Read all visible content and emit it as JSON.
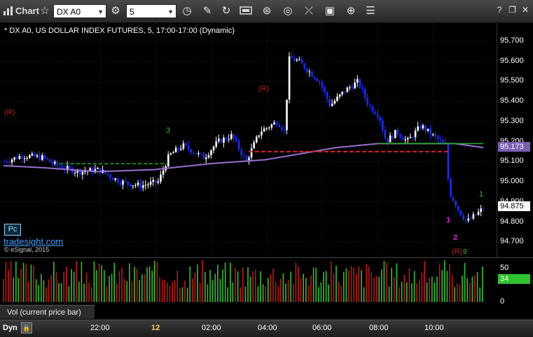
{
  "toolbar": {
    "chart_label": "Chart",
    "symbol_value": "DX A0",
    "interval_value": "5"
  },
  "chart": {
    "title": "* DX A0, US DOLLAR INDEX FUTURES, 5, 17:00-17:00 (Dynamic)",
    "price_labels": [
      "95.700",
      "95.600",
      "95.500",
      "95.400",
      "95.300",
      "95.200",
      "95.100",
      "95.000",
      "94.900",
      "94.800",
      "94.700"
    ],
    "last_price": "94.875",
    "ma_price": "95.173",
    "pc_tag": "Pc",
    "logo_text": "tradesight.com",
    "copyright": "© eSignal, 2015",
    "annotations": {
      "r_left": "(R)",
      "r_mid": "(R)",
      "r_bottom": "(R)",
      "count_3": "3",
      "count_1_green": "1",
      "count_1_magenta": "1",
      "count_2_magenta": "2",
      "count_9": "9"
    },
    "colors": {
      "up_candle": "#ffffff",
      "down_candle": "#1a2bff",
      "ma_line": "#9a6fd0",
      "support_line": "#e02020",
      "green_line": "#20b020",
      "setup_text": "#2fc22f",
      "annotation_red": "#c01818",
      "magenta": "#e020e0"
    }
  },
  "volume": {
    "label": "Vol (current price bar)",
    "scale_labels": [
      "50",
      "0"
    ],
    "current": "34"
  },
  "timeaxis": {
    "dyn_label": "Dyn",
    "labels": [
      "22:00",
      "12",
      "02:00",
      "04:00",
      "06:00",
      "08:00",
      "10:00"
    ]
  }
}
